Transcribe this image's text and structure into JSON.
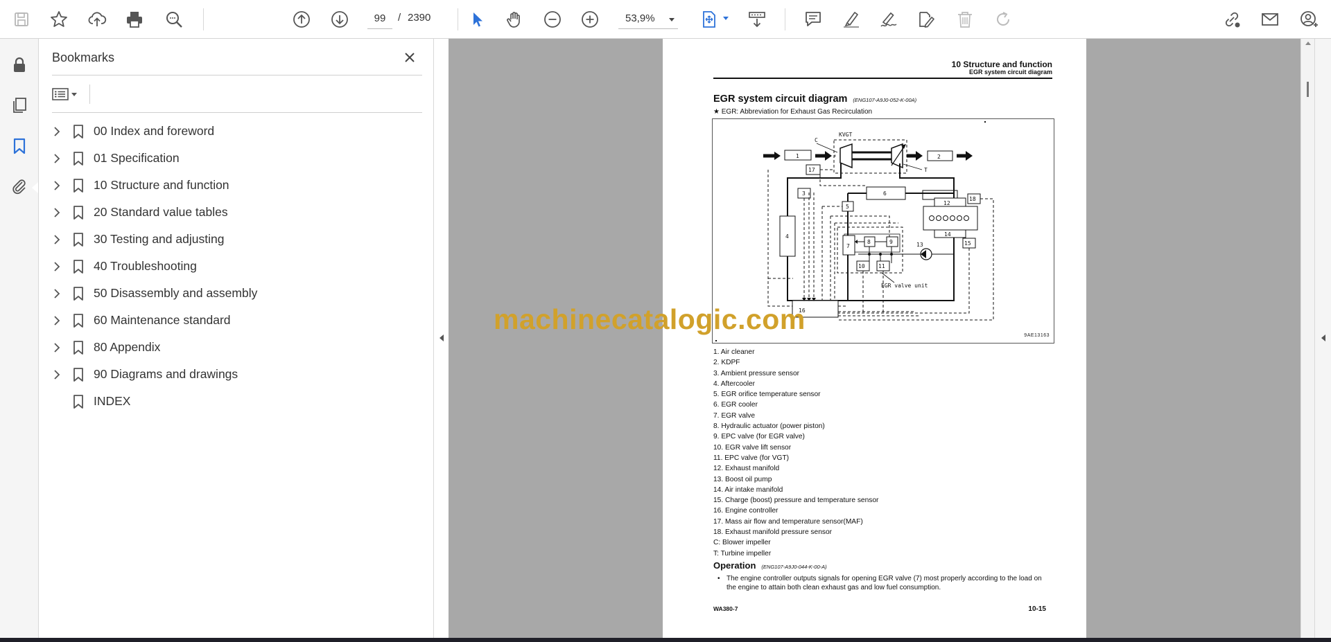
{
  "toolbar": {
    "page_current": "99",
    "page_sep": "/",
    "page_total": "2390",
    "zoom": "53,9%",
    "icons": [
      "save-icon",
      "star-icon",
      "upload-icon",
      "print-icon",
      "zoom-search-icon",
      "page-up-icon",
      "page-down-icon",
      "select-cursor-icon",
      "hand-icon",
      "zoom-out-icon",
      "zoom-in-icon",
      "fit-page-icon",
      "scroll-mode-icon",
      "comment-icon",
      "highlight-icon",
      "sign-icon",
      "edit-icon",
      "delete-icon",
      "redo-icon",
      "share-link-icon",
      "email-icon",
      "account-icon"
    ],
    "accent_color": "#2d72d9"
  },
  "rail": {
    "icons": [
      "lock-icon",
      "pages-icon",
      "bookmark-icon",
      "attachment-icon"
    ]
  },
  "bookmarks": {
    "title": "Bookmarks",
    "items": [
      {
        "label": "00 Index and foreword",
        "expandable": true
      },
      {
        "label": "01 Specification",
        "expandable": true
      },
      {
        "label": "10 Structure and function",
        "expandable": true
      },
      {
        "label": "20 Standard value tables",
        "expandable": true
      },
      {
        "label": "30 Testing and adjusting",
        "expandable": true
      },
      {
        "label": "40 Troubleshooting",
        "expandable": true
      },
      {
        "label": "50 Disassembly and assembly",
        "expandable": true
      },
      {
        "label": "60 Maintenance standard",
        "expandable": true
      },
      {
        "label": "80 Appendix",
        "expandable": true
      },
      {
        "label": "90 Diagrams and drawings",
        "expandable": true
      },
      {
        "label": "INDEX",
        "expandable": false
      }
    ]
  },
  "document": {
    "header_title": "10 Structure and function",
    "header_subtitle": "EGR system circuit diagram",
    "heading": "EGR system circuit diagram",
    "heading_code": "(ENG107-A9J0-052-K-00A)",
    "note": "★ EGR: Abbreviation for Exhaust Gas Recirculation",
    "diagram": {
      "code": "9AE13163",
      "labels": {
        "kvgt": "KVGT",
        "c": "C",
        "t": "T",
        "n1": "1",
        "n2": "2",
        "n3": "3",
        "n4": "4",
        "n5": "5",
        "n6": "6",
        "n7": "7",
        "n8": "8",
        "n9": "9",
        "n10": "10",
        "n11": "11",
        "n12": "12",
        "n13": "13",
        "n14": "14",
        "n15": "15",
        "n16": "16",
        "n17": "17",
        "n18": "18",
        "valve_unit": "EGR valve unit"
      }
    },
    "legend": [
      "1. Air cleaner",
      "2. KDPF",
      "3. Ambient pressure sensor",
      "4. Aftercooler",
      "5. EGR orifice temperature sensor",
      "6. EGR cooler",
      "7. EGR valve",
      "8. Hydraulic actuator (power piston)",
      "9. EPC valve (for EGR valve)",
      "10. EGR valve lift sensor",
      "11. EPC valve (for VGT)",
      "12. Exhaust manifold",
      "13. Boost oil pump",
      "14. Air intake manifold",
      "15. Charge (boost) pressure and temperature sensor",
      "16. Engine controller",
      "17. Mass air flow and temperature sensor(MAF)",
      "18. Exhaust manifold pressure sensor",
      "C: Blower impeller",
      "T: Turbine impeller"
    ],
    "operation_heading": "Operation",
    "operation_code": "(ENG107-A9J0-044-K-00-A)",
    "operation_text": "The engine controller outputs signals for opening EGR valve (7) most properly according to the load on the engine to attain both clean exhaust gas and low fuel consumption.",
    "footer_left": "WA380-7",
    "footer_right": "10-15"
  },
  "watermark": "machinecatalogic.com"
}
